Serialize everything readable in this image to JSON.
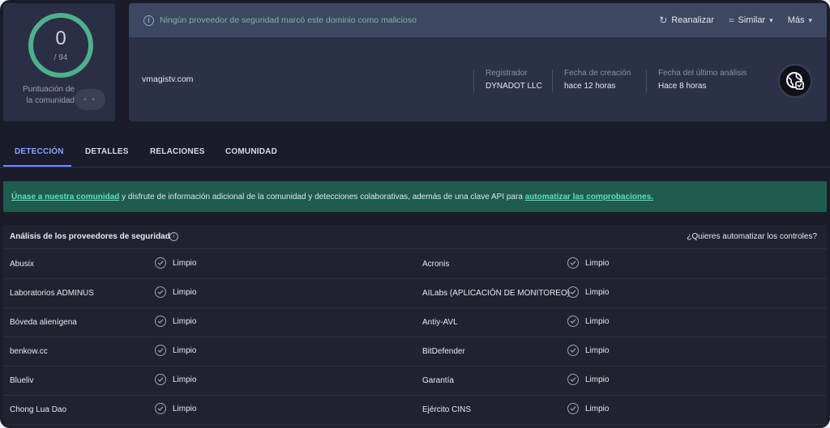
{
  "score": {
    "value": "0",
    "total": "/ 94",
    "label": "Puntuación de la comunidad",
    "toggle_glyph": "• •",
    "ring_color": "#4fb08c"
  },
  "alert": {
    "icon": "info-icon",
    "text": "Ningún proveedor de seguridad marcó este dominio como malicioso"
  },
  "actions": [
    {
      "label": "Reanalizar",
      "icon": "refresh-icon",
      "glyph": "↻",
      "chevron": ""
    },
    {
      "label": "Similar",
      "icon": "similar-icon",
      "glyph": "≈",
      "chevron": "▾"
    },
    {
      "label": "Más",
      "icon": "",
      "glyph": "",
      "chevron": "▾"
    }
  ],
  "domain": "vmagistv.com",
  "meta": [
    {
      "label": "Registrador",
      "value": "DYNADOT LLC"
    },
    {
      "label": "Fecha de creación",
      "value": "hace 12 horas"
    },
    {
      "label": "Fecha del último análisis",
      "value": "Hace 8 horas"
    }
  ],
  "tabs": [
    {
      "label": "DETECCIÓN",
      "active": true
    },
    {
      "label": "DETALLES",
      "active": false
    },
    {
      "label": "RELACIONES",
      "active": false
    },
    {
      "label": "COMUNIDAD",
      "active": false
    }
  ],
  "banner": {
    "link1": "Únase a nuestra comunidad",
    "middle": " y disfrute de información adicional de la comunidad y detecciones colaborativas, además de una clave API para ",
    "link2": "automatizar las comprobaciones."
  },
  "vendors": {
    "title": "Análisis de los proveedores de seguridad",
    "automate": "¿Quieres automatizar los controles?",
    "rows": [
      {
        "left": "Abusix",
        "left_status": "Limpio",
        "right": "Acronis",
        "right_status": "Limpio"
      },
      {
        "left": "Laboratorios ADMINUS",
        "left_status": "Limpio",
        "right": "AILabs (APLICACIÓN DE MONITOREO)",
        "right_status": "Limpio"
      },
      {
        "left": "Bóveda alienígena",
        "left_status": "Limpio",
        "right": "Antiy-AVL",
        "right_status": "Limpio"
      },
      {
        "left": "benkow.cc",
        "left_status": "Limpio",
        "right": "BitDefender",
        "right_status": "Limpio"
      },
      {
        "left": "Blueliv",
        "left_status": "Limpio",
        "right": "Garantía",
        "right_status": "Limpio"
      },
      {
        "left": "Chong Lua Dao",
        "left_status": "Limpio",
        "right": "Ejército CINS",
        "right_status": "Limpio"
      }
    ]
  },
  "colors": {
    "accent": "#6e8cff",
    "clean_check": "#9aa3b5",
    "banner_bg": "#1f5b4e",
    "banner_link": "#5fe0c0"
  }
}
